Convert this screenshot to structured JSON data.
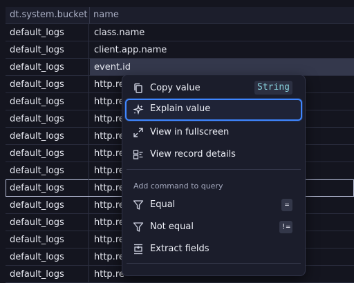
{
  "table": {
    "columns": [
      "dt.system.bucket",
      "name"
    ],
    "rows": [
      {
        "bucket": "default_logs",
        "name": "class.name"
      },
      {
        "bucket": "default_logs",
        "name": "client.app.name"
      },
      {
        "bucket": "default_logs",
        "name": "event.id"
      },
      {
        "bucket": "default_logs",
        "name": "http.re"
      },
      {
        "bucket": "default_logs",
        "name": "http.re"
      },
      {
        "bucket": "default_logs",
        "name": "http.re"
      },
      {
        "bucket": "default_logs",
        "name": "http.re"
      },
      {
        "bucket": "default_logs",
        "name": "http.re"
      },
      {
        "bucket": "default_logs",
        "name": "http.re"
      },
      {
        "bucket": "default_logs",
        "name": "http.re"
      },
      {
        "bucket": "default_logs",
        "name": "http.re"
      },
      {
        "bucket": "default_logs",
        "name": "http.re"
      },
      {
        "bucket": "default_logs",
        "name": "http.re"
      },
      {
        "bucket": "default_logs",
        "name": "http.re"
      },
      {
        "bucket": "default_logs",
        "name": "http.re"
      }
    ]
  },
  "menu": {
    "copy_value": "Copy value",
    "type_badge": "String",
    "explain_value": "Explain value",
    "view_fullscreen": "View in fullscreen",
    "view_record_details": "View record details",
    "section_label": "Add command to query",
    "equal": "Equal",
    "equal_key": "=",
    "not_equal": "Not equal",
    "not_equal_key": "!=",
    "extract_fields": "Extract fields"
  },
  "icons": {
    "copy": "copy-icon",
    "explain": "sparkle-icon",
    "fullscreen": "expand-icon",
    "details": "record-details-icon",
    "filter": "filter-icon",
    "extract": "extract-fields-icon"
  },
  "colors": {
    "accent": "#3f86ff",
    "badge_text": "#88d1dc",
    "background": "#14151f"
  }
}
